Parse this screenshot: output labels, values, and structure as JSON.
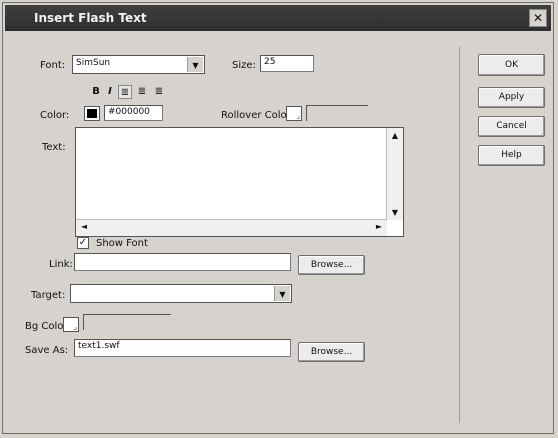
{
  "window": {
    "title": "Insert Flash Text",
    "close_glyph": "✕"
  },
  "font": {
    "label": "Font:",
    "value": "SimSun"
  },
  "size": {
    "label": "Size:",
    "value": "25"
  },
  "format_buttons": {
    "bold": "B",
    "italic": "I",
    "align_left": "≣",
    "align_center": "≣",
    "align_right": "≣"
  },
  "color": {
    "label": "Color:",
    "value": "#000000",
    "swatch": "#000000"
  },
  "rollover_color": {
    "label": "Rollover Color:",
    "value": ""
  },
  "text": {
    "label": "Text:",
    "value": ""
  },
  "scroll": {
    "up": "▲",
    "down": "▼",
    "left": "◄",
    "right": "►"
  },
  "show_font": {
    "label": "Show Font",
    "checked": "✓"
  },
  "link": {
    "label": "Link:",
    "value": "",
    "browse_label": "Browse..."
  },
  "target": {
    "label": "Target:",
    "value": ""
  },
  "bg_color": {
    "label": "Bg Color:",
    "value": ""
  },
  "save_as": {
    "label": "Save As:",
    "value": "text1.swf",
    "browse_label": "Browse..."
  },
  "buttons": {
    "ok": "OK",
    "apply": "Apply",
    "cancel": "Cancel",
    "help": "Help"
  },
  "dropdown_arrow": "▼"
}
